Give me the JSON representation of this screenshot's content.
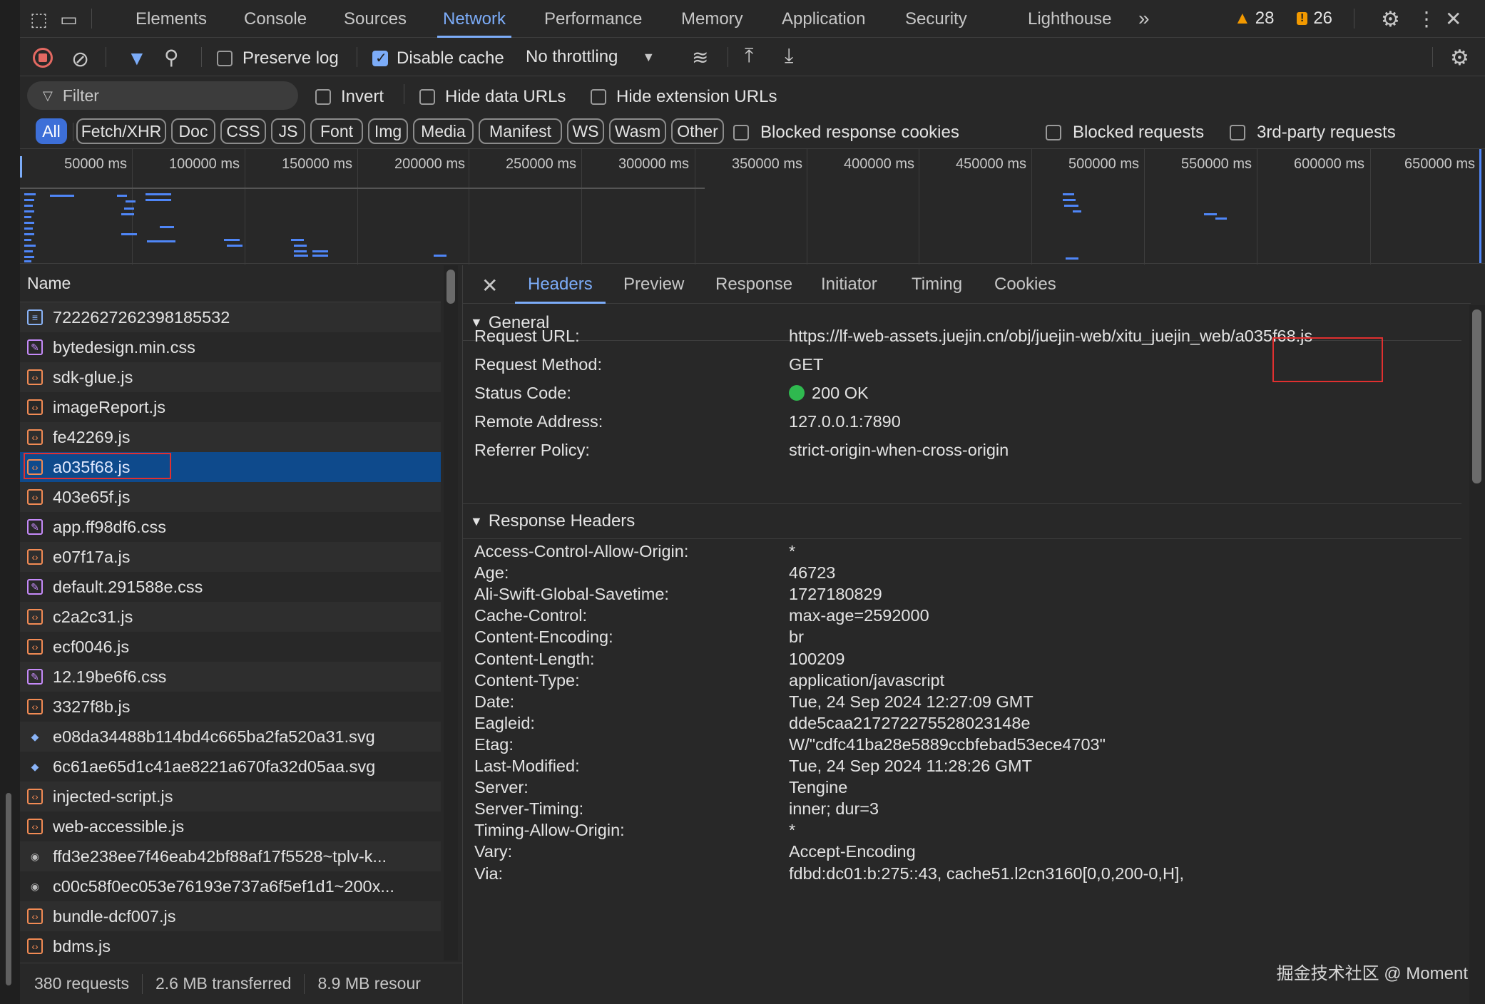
{
  "main_tabs": [
    "Elements",
    "Console",
    "Sources",
    "Network",
    "Performance",
    "Memory",
    "Application",
    "Security",
    "Lighthouse"
  ],
  "active_tab": "Network",
  "warnings_count": "28",
  "issues_count": "26",
  "toolbar": {
    "preserve_log": "Preserve log",
    "disable_cache": "Disable cache",
    "throttling": "No throttling"
  },
  "filter": {
    "placeholder": "Filter",
    "invert": "Invert",
    "hide_data_urls": "Hide data URLs",
    "hide_extension_urls": "Hide extension URLs"
  },
  "type_chips": [
    "All",
    "Fetch/XHR",
    "Doc",
    "CSS",
    "JS",
    "Font",
    "Img",
    "Media",
    "Manifest",
    "WS",
    "Wasm",
    "Other"
  ],
  "extra_filters": {
    "blocked_cookies": "Blocked response cookies",
    "blocked_requests": "Blocked requests",
    "third_party": "3rd-party requests"
  },
  "timeline_ticks": [
    "50000 ms",
    "100000 ms",
    "150000 ms",
    "200000 ms",
    "250000 ms",
    "300000 ms",
    "350000 ms",
    "400000 ms",
    "450000 ms",
    "500000 ms",
    "550000 ms",
    "600000 ms",
    "650000 ms"
  ],
  "request_list": {
    "header": "Name",
    "items": [
      {
        "name": "7222627262398185532",
        "type": "doc"
      },
      {
        "name": "bytedesign.min.css",
        "type": "css"
      },
      {
        "name": "sdk-glue.js",
        "type": "js"
      },
      {
        "name": "imageReport.js",
        "type": "js"
      },
      {
        "name": "fe42269.js",
        "type": "js"
      },
      {
        "name": "a035f68.js",
        "type": "js",
        "selected": true
      },
      {
        "name": "403e65f.js",
        "type": "js"
      },
      {
        "name": "app.ff98df6.css",
        "type": "css"
      },
      {
        "name": "e07f17a.js",
        "type": "js"
      },
      {
        "name": "default.291588e.css",
        "type": "css"
      },
      {
        "name": "c2a2c31.js",
        "type": "js"
      },
      {
        "name": "ecf0046.js",
        "type": "js"
      },
      {
        "name": "12.19be6f6.css",
        "type": "css"
      },
      {
        "name": "3327f8b.js",
        "type": "js"
      },
      {
        "name": "e08da34488b114bd4c665ba2fa520a31.svg",
        "type": "svg"
      },
      {
        "name": "6c61ae65d1c41ae8221a670fa32d05aa.svg",
        "type": "svg"
      },
      {
        "name": "injected-script.js",
        "type": "js"
      },
      {
        "name": "web-accessible.js",
        "type": "js"
      },
      {
        "name": "ffd3e238ee7f46eab42bf88af17f5528~tplv-k...",
        "type": "img"
      },
      {
        "name": "c00c58f0ec053e76193e737a6f5ef1d1~200x...",
        "type": "img"
      },
      {
        "name": "bundle-dcf007.js",
        "type": "js"
      },
      {
        "name": "bdms.js",
        "type": "js"
      }
    ]
  },
  "status_bar": {
    "requests": "380 requests",
    "transferred": "2.6 MB transferred",
    "resources": "8.9 MB resour"
  },
  "detail_tabs": [
    "Headers",
    "Preview",
    "Response",
    "Initiator",
    "Timing",
    "Cookies"
  ],
  "active_detail_tab": "Headers",
  "general": {
    "title": "General",
    "rows": [
      {
        "k": "Request URL:",
        "v": "https://lf-web-assets.juejin.cn/obj/juejin-web/xitu_juejin_web/a035f68.js"
      },
      {
        "k": "Request Method:",
        "v": "GET"
      },
      {
        "k": "Status Code:",
        "v": "200 OK"
      },
      {
        "k": "Remote Address:",
        "v": "127.0.0.1:7890"
      },
      {
        "k": "Referrer Policy:",
        "v": "strict-origin-when-cross-origin"
      }
    ]
  },
  "response_headers": {
    "title": "Response Headers",
    "rows": [
      {
        "k": "Access-Control-Allow-Origin:",
        "v": "*"
      },
      {
        "k": "Age:",
        "v": "46723"
      },
      {
        "k": "Ali-Swift-Global-Savetime:",
        "v": "1727180829"
      },
      {
        "k": "Cache-Control:",
        "v": "max-age=2592000"
      },
      {
        "k": "Content-Encoding:",
        "v": "br"
      },
      {
        "k": "Content-Length:",
        "v": "100209"
      },
      {
        "k": "Content-Type:",
        "v": "application/javascript"
      },
      {
        "k": "Date:",
        "v": "Tue, 24 Sep 2024 12:27:09 GMT"
      },
      {
        "k": "Eagleid:",
        "v": "dde5caa217272275528023148e"
      },
      {
        "k": "Etag:",
        "v": "W/\"cdfc41ba28e5889ccbfebad53ece4703\""
      },
      {
        "k": "Last-Modified:",
        "v": "Tue, 24 Sep 2024 11:28:26 GMT"
      },
      {
        "k": "Server:",
        "v": "Tengine"
      },
      {
        "k": "Server-Timing:",
        "v": "inner; dur=3"
      },
      {
        "k": "Timing-Allow-Origin:",
        "v": "*"
      },
      {
        "k": "Vary:",
        "v": "Accept-Encoding"
      },
      {
        "k": "Via:",
        "v": "fdbd:dc01:b:275::43, cache51.l2cn3160[0,0,200-0,H],"
      }
    ]
  },
  "watermark": "掘金技术社区 @ Moment",
  "colors": {
    "accent": "#7cacf8",
    "selected_row": "#0e4a8c",
    "status_ok": "#2fb94f",
    "highlight_box": "#e03030"
  }
}
